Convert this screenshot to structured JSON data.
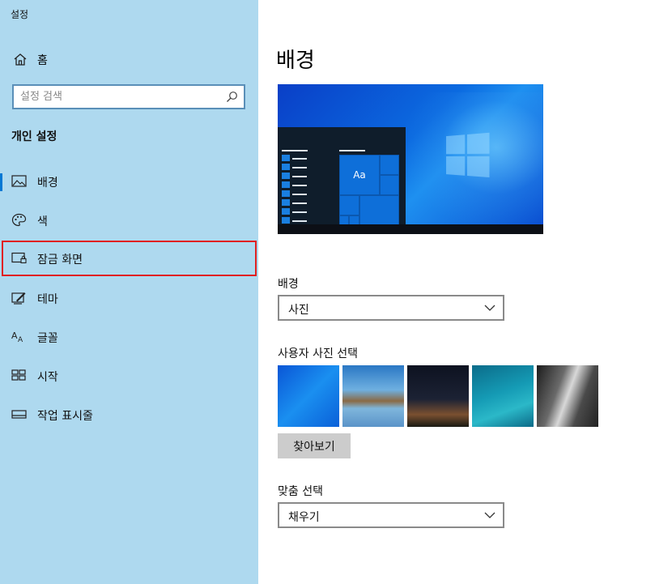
{
  "app": {
    "title": "설정"
  },
  "sidebar": {
    "home": {
      "label": "홈",
      "icon": "home-icon"
    },
    "search": {
      "placeholder": "설정 검색",
      "icon": "search-icon"
    },
    "section_title": "개인 설정",
    "items": [
      {
        "label": "배경",
        "icon": "picture-icon",
        "active": true
      },
      {
        "label": "색",
        "icon": "palette-icon"
      },
      {
        "label": "잠금 화면",
        "icon": "lock-screen-icon",
        "highlighted": true
      },
      {
        "label": "테마",
        "icon": "theme-brush-icon"
      },
      {
        "label": "글꼴",
        "icon": "font-icon"
      },
      {
        "label": "시작",
        "icon": "start-grid-icon"
      },
      {
        "label": "작업 표시줄",
        "icon": "taskbar-icon"
      }
    ]
  },
  "main": {
    "title": "배경",
    "preview": {
      "tile_text": "Aa"
    },
    "background": {
      "label": "배경",
      "value": "사진"
    },
    "choose_picture": {
      "label": "사용자 사진 선택",
      "browse_label": "찾아보기"
    },
    "fit": {
      "label": "맞춤 선택",
      "value": "채우기"
    }
  },
  "colors": {
    "sidebar_bg": "#aed9ef",
    "accent": "#0078d4",
    "highlight_border": "#e02020"
  }
}
